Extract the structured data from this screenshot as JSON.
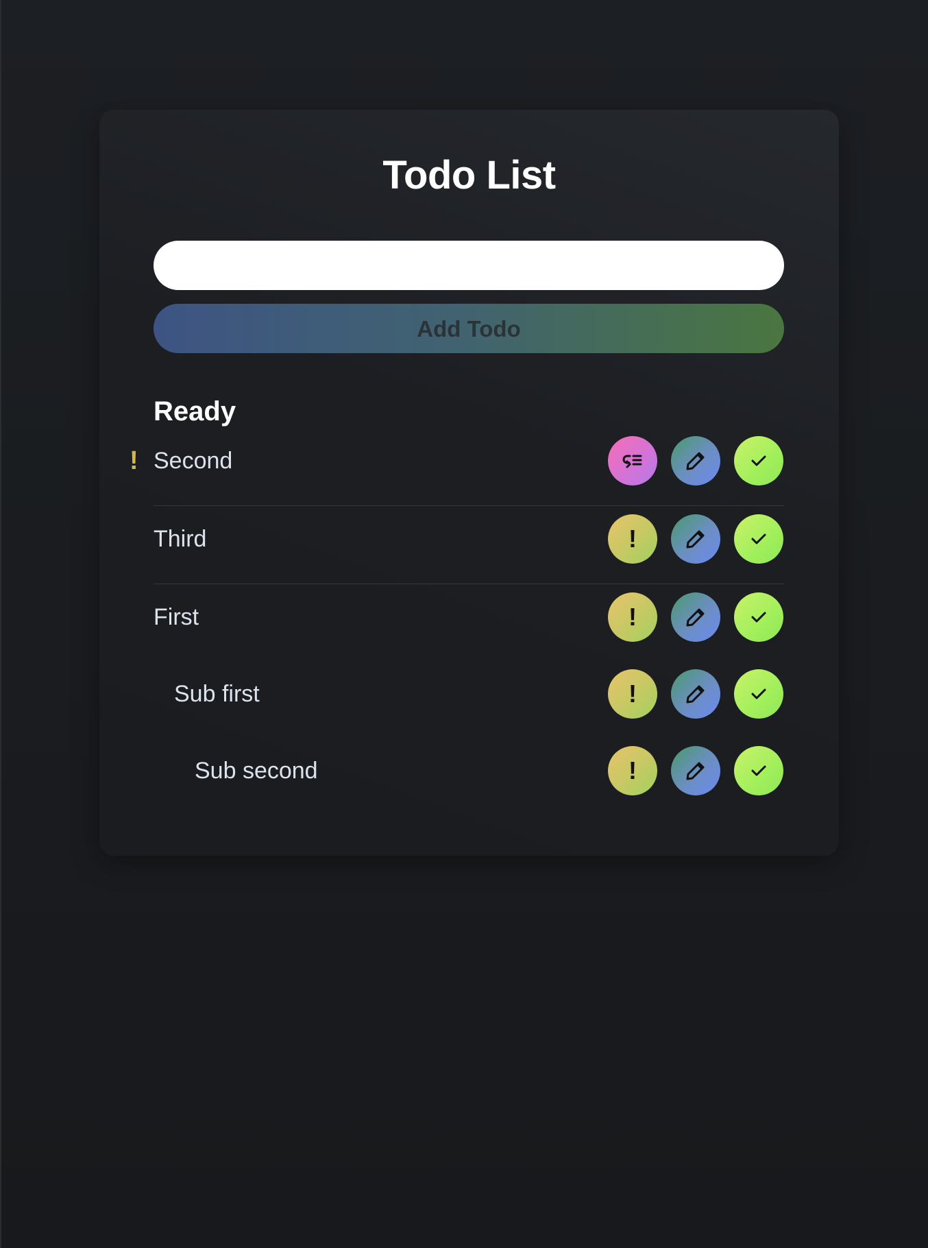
{
  "app": {
    "title": "Todo List"
  },
  "input": {
    "value": "",
    "placeholder": ""
  },
  "add_button": {
    "label": "Add Todo"
  },
  "section": {
    "heading": "Ready"
  },
  "todos": [
    {
      "label": "Second",
      "indent_level": 0,
      "priority": true,
      "priority_mark": "!"
    },
    {
      "label": "Third",
      "indent_level": 0,
      "priority": false
    },
    {
      "label": "First",
      "indent_level": 0,
      "priority": false
    },
    {
      "label": "Sub first",
      "indent_level": 1,
      "priority": false
    },
    {
      "label": "Sub second",
      "indent_level": 2,
      "priority": false
    }
  ],
  "icons": {
    "priority": "exclamation-icon",
    "unprioritize": "list-return-icon",
    "edit": "pencil-icon",
    "complete": "check-icon"
  },
  "colors": {
    "background": "#18191c",
    "card": "#1e2024",
    "title_text": "#ffffff",
    "item_text": "#dce3ec",
    "priority_mark": "#d6b845",
    "add_button_start": "#3d5483",
    "add_button_end": "#4a7640"
  }
}
